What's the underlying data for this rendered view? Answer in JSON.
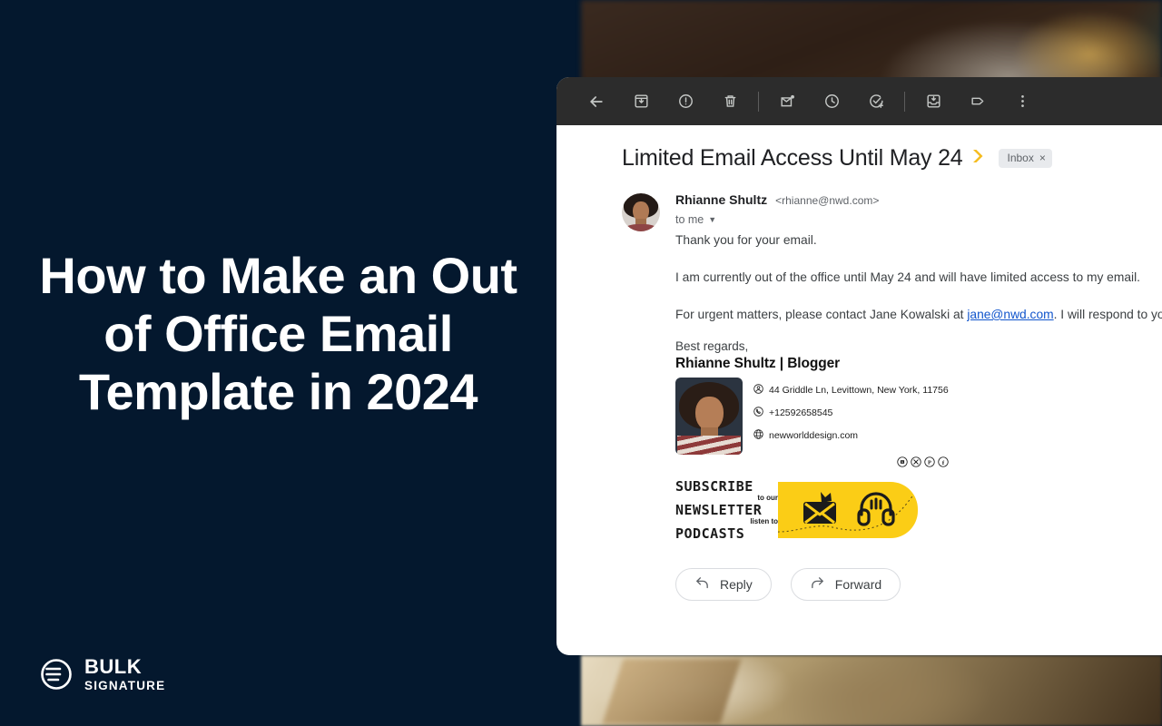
{
  "promo": {
    "title": "How to Make an Out of Office Email Template in 2024",
    "brand_top": "BULK",
    "brand_bottom": "SIGNATURE",
    "background_color": "#04182e",
    "text_color": "#ffffff"
  },
  "mail": {
    "toolbar": {
      "buttons": [
        {
          "name": "back-icon",
          "label": "Back to inbox"
        },
        {
          "name": "archive-icon",
          "label": "Archive"
        },
        {
          "name": "report-spam-icon",
          "label": "Report spam"
        },
        {
          "name": "delete-icon",
          "label": "Delete"
        },
        {
          "name": "mark-unread-icon",
          "label": "Mark as unread"
        },
        {
          "name": "snooze-icon",
          "label": "Snooze"
        },
        {
          "name": "add-to-tasks-icon",
          "label": "Add to tasks"
        },
        {
          "name": "move-to-inbox-icon",
          "label": "Move to inbox"
        },
        {
          "name": "label-icon",
          "label": "Labels"
        },
        {
          "name": "more-options-icon",
          "label": "More"
        }
      ],
      "background_color": "#2c2c2c"
    },
    "subject": "Limited Email Access Until May 24",
    "important_marker_color": "#f5bc1f",
    "inbox_chip": "Inbox",
    "inbox_chip_close": "×",
    "sender": {
      "name": "Rhianne Shultz",
      "email": "<rhianne@nwd.com>",
      "recipient": "to me"
    },
    "body": {
      "p1": "Thank you for your email.",
      "p2": "I am currently out of the office until May 24 and will have limited access to my email.",
      "p3_before": "For urgent matters, please contact Jane Kowalski at ",
      "p3_link": "jane@nwd.com",
      "p3_after": ". I will respond to your email upon"
    },
    "signature": {
      "regards": "Best regards,",
      "name_role": "Rhianne Shultz | Blogger",
      "address": "44 Griddle Ln, Levittown, New York, 11756",
      "phone": "+12592658545",
      "website": "newworlddesign.com",
      "social": [
        {
          "name": "youtube-icon",
          "glyph": "▶"
        },
        {
          "name": "x-twitter-icon",
          "glyph": "✕"
        },
        {
          "name": "pinterest-icon",
          "glyph": "P"
        },
        {
          "name": "facebook-icon",
          "glyph": "f"
        }
      ],
      "banner": {
        "line1": "SUBSCRIBE",
        "line2": "to our",
        "line3": "NEWSLETTER",
        "line4": "listen to",
        "line5": "PODCASTS",
        "color": "#fbcd16"
      }
    },
    "actions": {
      "reply": "Reply",
      "forward": "Forward"
    }
  }
}
